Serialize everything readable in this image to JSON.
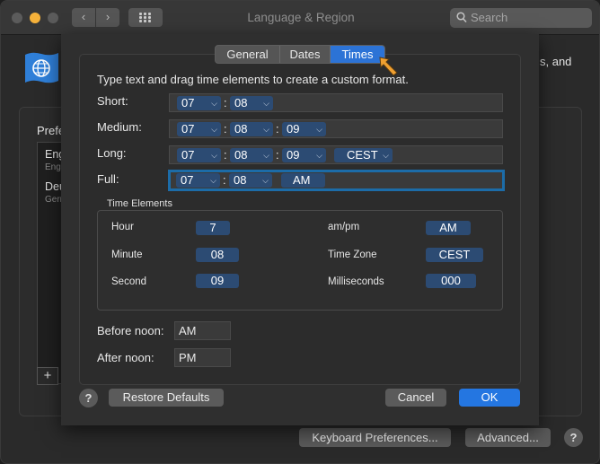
{
  "window": {
    "title": "Language & Region",
    "search_placeholder": "Search",
    "description_tail": "s, and"
  },
  "preferred": {
    "heading": "Prefe",
    "languages": [
      {
        "name": "Eng",
        "sub": "Eng"
      },
      {
        "name": "Deu",
        "sub": "Gern"
      }
    ],
    "add_label": "+"
  },
  "footer": {
    "keyboard_prefs": "Keyboard Preferences...",
    "advanced": "Advanced...",
    "help": "?"
  },
  "sheet": {
    "tabs": [
      {
        "label": "General",
        "active": false
      },
      {
        "label": "Dates",
        "active": false
      },
      {
        "label": "Times",
        "active": true
      }
    ],
    "instruction": "Type text and drag time elements to create a custom format.",
    "formats": {
      "short": {
        "label": "Short:",
        "tokens": [
          "07",
          "08"
        ]
      },
      "medium": {
        "label": "Medium:",
        "tokens": [
          "07",
          "08",
          "09"
        ]
      },
      "long": {
        "label": "Long:",
        "tokens": [
          "07",
          "08",
          "09",
          "CEST"
        ]
      },
      "full": {
        "label": "Full:",
        "tokens": [
          "07",
          "08",
          "AM"
        ]
      }
    },
    "separator": ":",
    "time_elements": {
      "title": "Time Elements",
      "hour": {
        "label": "Hour",
        "value": "7"
      },
      "minute": {
        "label": "Minute",
        "value": "08"
      },
      "second": {
        "label": "Second",
        "value": "09"
      },
      "ampm": {
        "label": "am/pm",
        "value": "AM"
      },
      "timezone": {
        "label": "Time Zone",
        "value": "CEST"
      },
      "milliseconds": {
        "label": "Milliseconds",
        "value": "000"
      }
    },
    "before_noon": {
      "label": "Before noon:",
      "value": "AM"
    },
    "after_noon": {
      "label": "After noon:",
      "value": "PM"
    },
    "help": "?",
    "restore_defaults": "Restore Defaults",
    "cancel": "Cancel",
    "ok": "OK"
  },
  "colors": {
    "accent": "#2476e1",
    "token": "#2c4b73",
    "focus_ring": "#1c6ca8",
    "cursor_arrow": "#f0a030"
  }
}
